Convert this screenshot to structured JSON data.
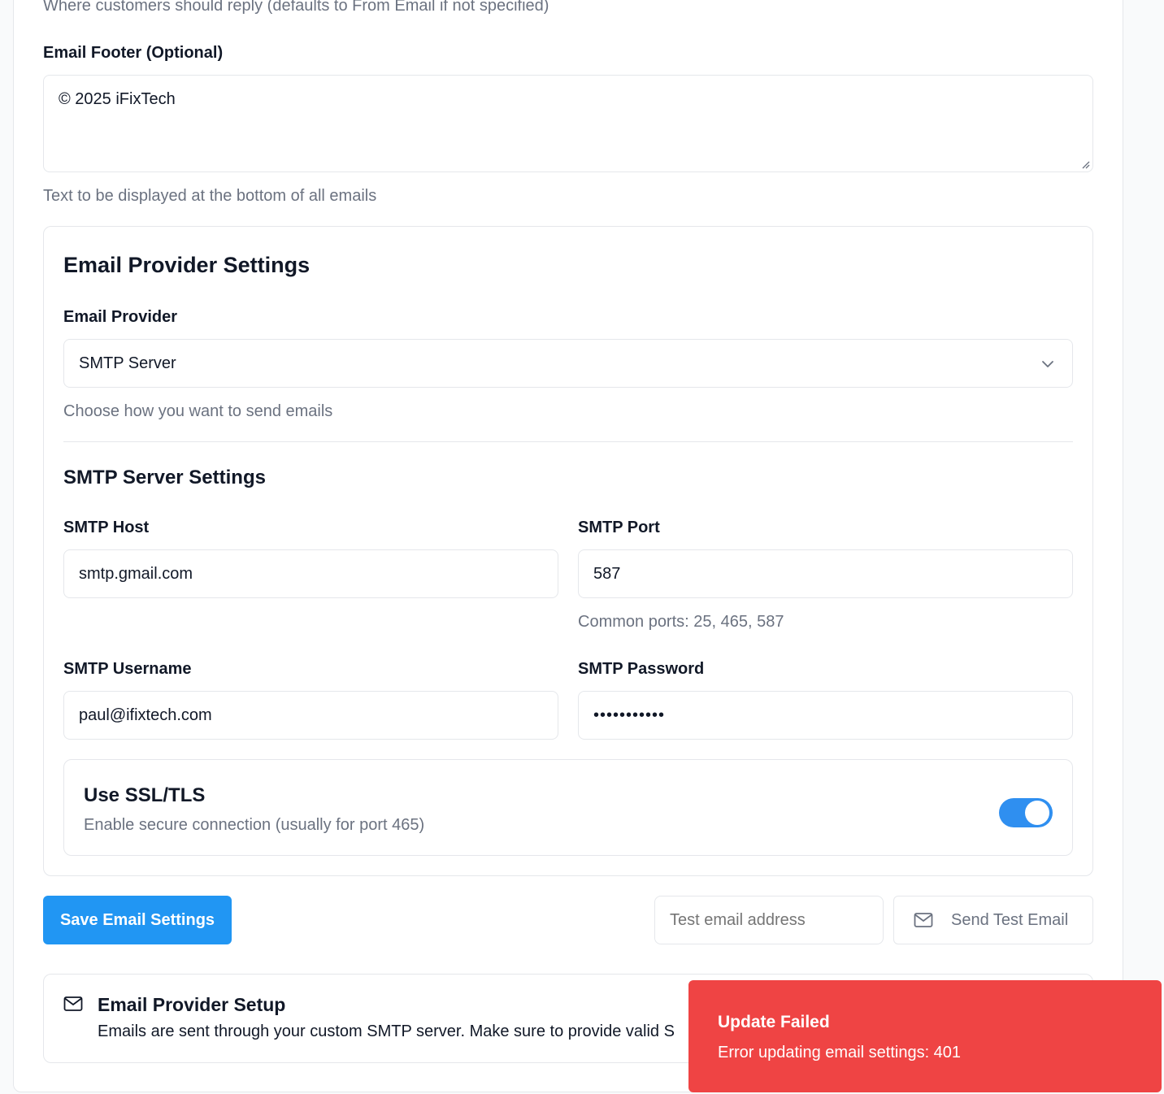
{
  "reply_to": {
    "help": "Where customers should reply (defaults to From Email if not specified)"
  },
  "footer": {
    "label": "Email Footer (Optional)",
    "value": "© 2025 iFixTech",
    "help": "Text to be displayed at the bottom of all emails"
  },
  "provider_settings": {
    "title": "Email Provider Settings",
    "provider_label": "Email Provider",
    "provider_value": "SMTP Server",
    "provider_help": "Choose how you want to send emails"
  },
  "smtp": {
    "title": "SMTP Server Settings",
    "host_label": "SMTP Host",
    "host_value": "smtp.gmail.com",
    "port_label": "SMTP Port",
    "port_value": "587",
    "port_help": "Common ports: 25, 465, 587",
    "username_label": "SMTP Username",
    "username_value": "paul@ifixtech.com",
    "password_label": "SMTP Password",
    "password_value": "•••••••••••",
    "ssl_title": "Use SSL/TLS",
    "ssl_help": "Enable secure connection (usually for port 465)",
    "ssl_enabled": true
  },
  "actions": {
    "save_label": "Save Email Settings",
    "test_email_placeholder": "Test email address",
    "send_test_label": "Send Test Email"
  },
  "setup_info": {
    "title": "Email Provider Setup",
    "body": "Emails are sent through your custom SMTP server. Make sure to provide valid S"
  },
  "toast": {
    "title": "Update Failed",
    "message": "Error updating email settings: 401"
  },
  "colors": {
    "primary": "#2196f3",
    "toast_error": "#ef4444",
    "toggle_on": "#2f8ff0"
  }
}
